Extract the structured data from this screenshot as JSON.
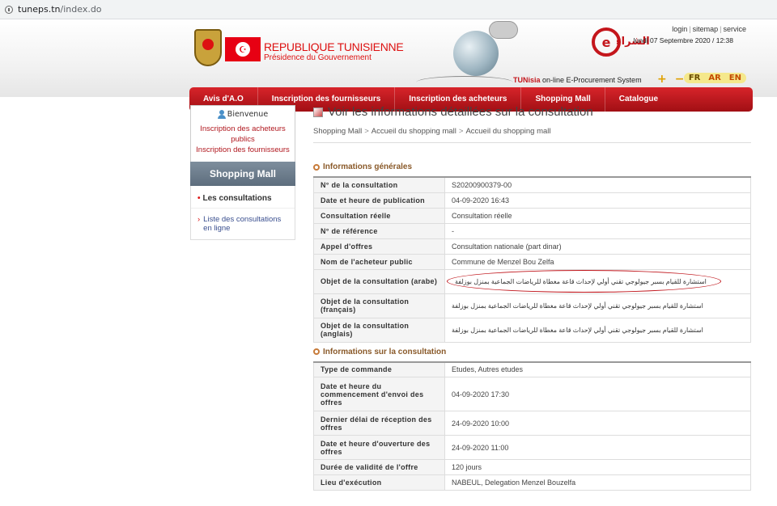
{
  "browser": {
    "host": "tuneps.tn",
    "path": "/index.do"
  },
  "header": {
    "rep_title": "REPUBLIQUE TUNISIENNE",
    "rep_sub": "Présidence du Gouvernement",
    "logo_letter": "e",
    "logo_arabic": "الشراء",
    "eproc_brand": "TUNisia",
    "eproc_text": " on-line E-Procurement System",
    "links": [
      "login",
      "sitemap",
      "service"
    ],
    "date": "lundi 07 Septembre 2020 / 12:38",
    "zoom_plus": "+",
    "zoom_minus": "−",
    "langs": [
      "FR",
      "AR",
      "EN"
    ]
  },
  "nav": [
    "Avis d'A.O",
    "Inscription des fournisseurs",
    "Inscription des acheteurs",
    "Shopping Mall",
    "Catalogue"
  ],
  "sidebar": {
    "welcome": "Bienvenue",
    "link1": "Inscription des acheteurs publics",
    "link2": "Inscription des fournisseurs",
    "section": "Shopping Mall",
    "consultations": "Les consultations",
    "list": "Liste des consultations en ligne"
  },
  "main": {
    "title": "Voir les informations détaillées sur la consultation",
    "breadcrumb": [
      "Shopping Mall",
      "Accueil du shopping mall",
      "Accueil du shopping mall"
    ],
    "section1": "Informations générales",
    "section2": "Informations sur la consultation",
    "general": [
      {
        "label": "N° de la consultation",
        "value": "S20200900379-00"
      },
      {
        "label": "Date et heure de publication",
        "value": "04-09-2020 16:43"
      },
      {
        "label": "Consultation réelle",
        "value": "Consultation réelle"
      },
      {
        "label": "N° de référence",
        "value": "-"
      },
      {
        "label": "Appel d'offres",
        "value": "Consultation nationale (part dinar)"
      },
      {
        "label": "Nom de l'acheteur public",
        "value": "Commune de Menzel Bou Zelfa"
      },
      {
        "label": "Objet de la consultation (arabe)",
        "value": "استشارة للقيام بسبر جيولوجي تقني أولي لإحداث قاعة مغطاة للرياضات الجماعية بمنزل بوزلفة"
      },
      {
        "label": "Objet de la consultation (français)",
        "value": "استشارة للقيام بسبر جيولوجي تقني أولي لإحداث قاعة مغطاة للرياضات الجماعية بمنزل بوزلفة"
      },
      {
        "label": "Objet de la consultation (anglais)",
        "value": "استشارة للقيام بسبر جيولوجي تقني أولي لإحداث قاعة مغطاة للرياضات الجماعية بمنزل بوزلفة"
      }
    ],
    "consultation": [
      {
        "label": "Type de commande",
        "value": "Etudes, Autres etudes"
      },
      {
        "label": "Date et heure du commencement d'envoi des offres",
        "value": "04-09-2020 17:30"
      },
      {
        "label": "Dernier délai de réception des offres",
        "value": "24-09-2020 10:00"
      },
      {
        "label": "Date et heure d'ouverture des offres",
        "value": "24-09-2020 11:00"
      },
      {
        "label": "Durée de validité de l'offre",
        "value": "120 jours"
      },
      {
        "label": "Lieu d'exécution",
        "value": "NABEUL, Delegation Menzel Bouzelfa"
      }
    ]
  }
}
